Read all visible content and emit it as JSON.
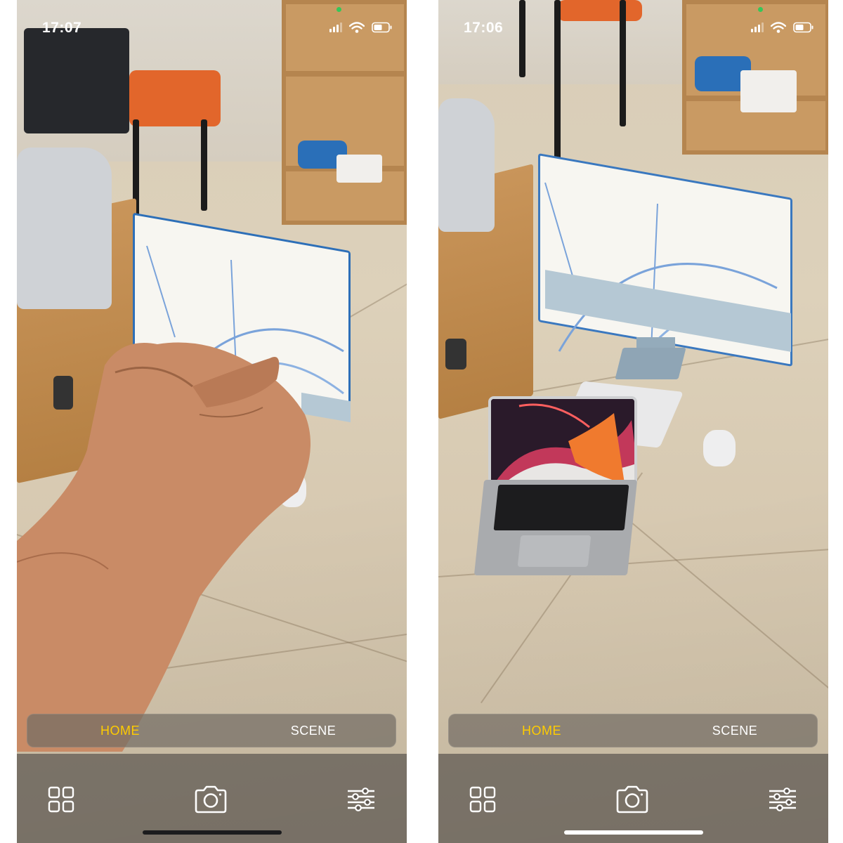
{
  "screens": [
    {
      "id": "left",
      "status": {
        "time": "17:07"
      },
      "modes": {
        "home_label": "HOME",
        "scene_label": "SCENE",
        "active": "HOME"
      },
      "toolbar": {
        "gallery_icon": "grid-icon",
        "capture_icon": "camera-icon",
        "settings_icon": "sliders-icon"
      }
    },
    {
      "id": "right",
      "status": {
        "time": "17:06"
      },
      "modes": {
        "home_label": "HOME",
        "scene_label": "SCENE",
        "active": "HOME"
      },
      "toolbar": {
        "gallery_icon": "grid-icon",
        "capture_icon": "camera-icon",
        "settings_icon": "sliders-icon"
      }
    }
  ],
  "colors": {
    "active_tab": "#ffcc00",
    "inactive_tab": "#ffffff",
    "privacy_indicator": "#34c759",
    "home_indicator_left": "#1c1c1e",
    "home_indicator_right": "#ffffff"
  }
}
